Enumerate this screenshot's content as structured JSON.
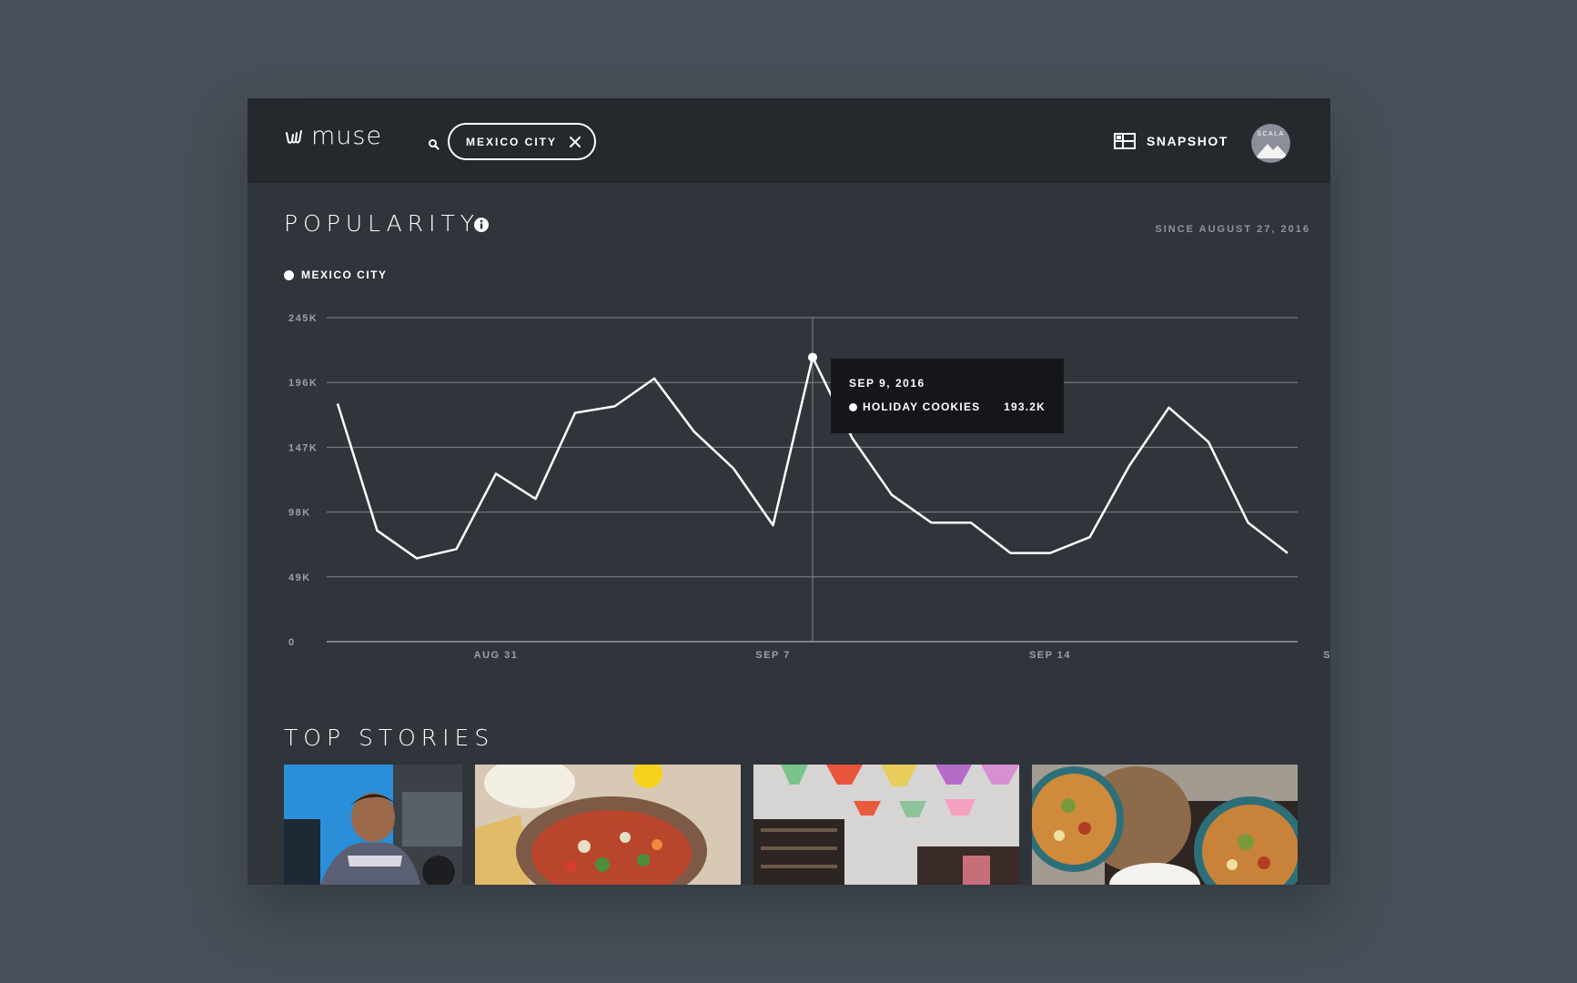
{
  "app": {
    "logo_text": "muse"
  },
  "search": {
    "chip_label": "MEXICO CITY"
  },
  "header": {
    "snapshot_label": "SNAPSHOT",
    "avatar_label": "SCALA"
  },
  "popularity": {
    "title": "POPULARITY",
    "since_label": "SINCE AUGUST 27, 2016",
    "legend_label": "MEXICO CITY"
  },
  "tooltip": {
    "date": "SEP 9, 2016",
    "series": "HOLIDAY COOKIES",
    "value": "193.2K"
  },
  "chart_data": {
    "type": "line",
    "title": "",
    "xlabel": "",
    "ylabel": "",
    "ylim": [
      0,
      245000
    ],
    "y_ticks": [
      {
        "value": 0,
        "label": "0"
      },
      {
        "value": 49000,
        "label": "49K"
      },
      {
        "value": 98000,
        "label": "98K"
      },
      {
        "value": 147000,
        "label": "147K"
      },
      {
        "value": 196000,
        "label": "196K"
      },
      {
        "value": 245000,
        "label": "245K"
      }
    ],
    "x_ticks": [
      {
        "day": 4,
        "label": "AUG 31"
      },
      {
        "day": 11,
        "label": "SEP 7"
      },
      {
        "day": 18,
        "label": "SEP 14"
      },
      {
        "day": 25,
        "label": "S"
      }
    ],
    "grid": true,
    "highlight_day": 13,
    "series": [
      {
        "name": "MEXICO CITY",
        "color": "#ffffff",
        "values": [
          180000,
          84000,
          63000,
          70000,
          127000,
          108000,
          173000,
          178000,
          199000,
          159000,
          131000,
          88000,
          215000,
          154000,
          111000,
          90000,
          90000,
          67000,
          67000,
          79000,
          133000,
          177000,
          151000,
          90000,
          67000
        ]
      }
    ]
  },
  "top_stories": {
    "title": "TOP STORIES"
  },
  "colors": {
    "page_bg": "#474f58",
    "panel_bg": "#30353b",
    "topbar_bg": "#25292e",
    "tooltip_bg": "#141619",
    "muted_text": "#8e959d"
  }
}
